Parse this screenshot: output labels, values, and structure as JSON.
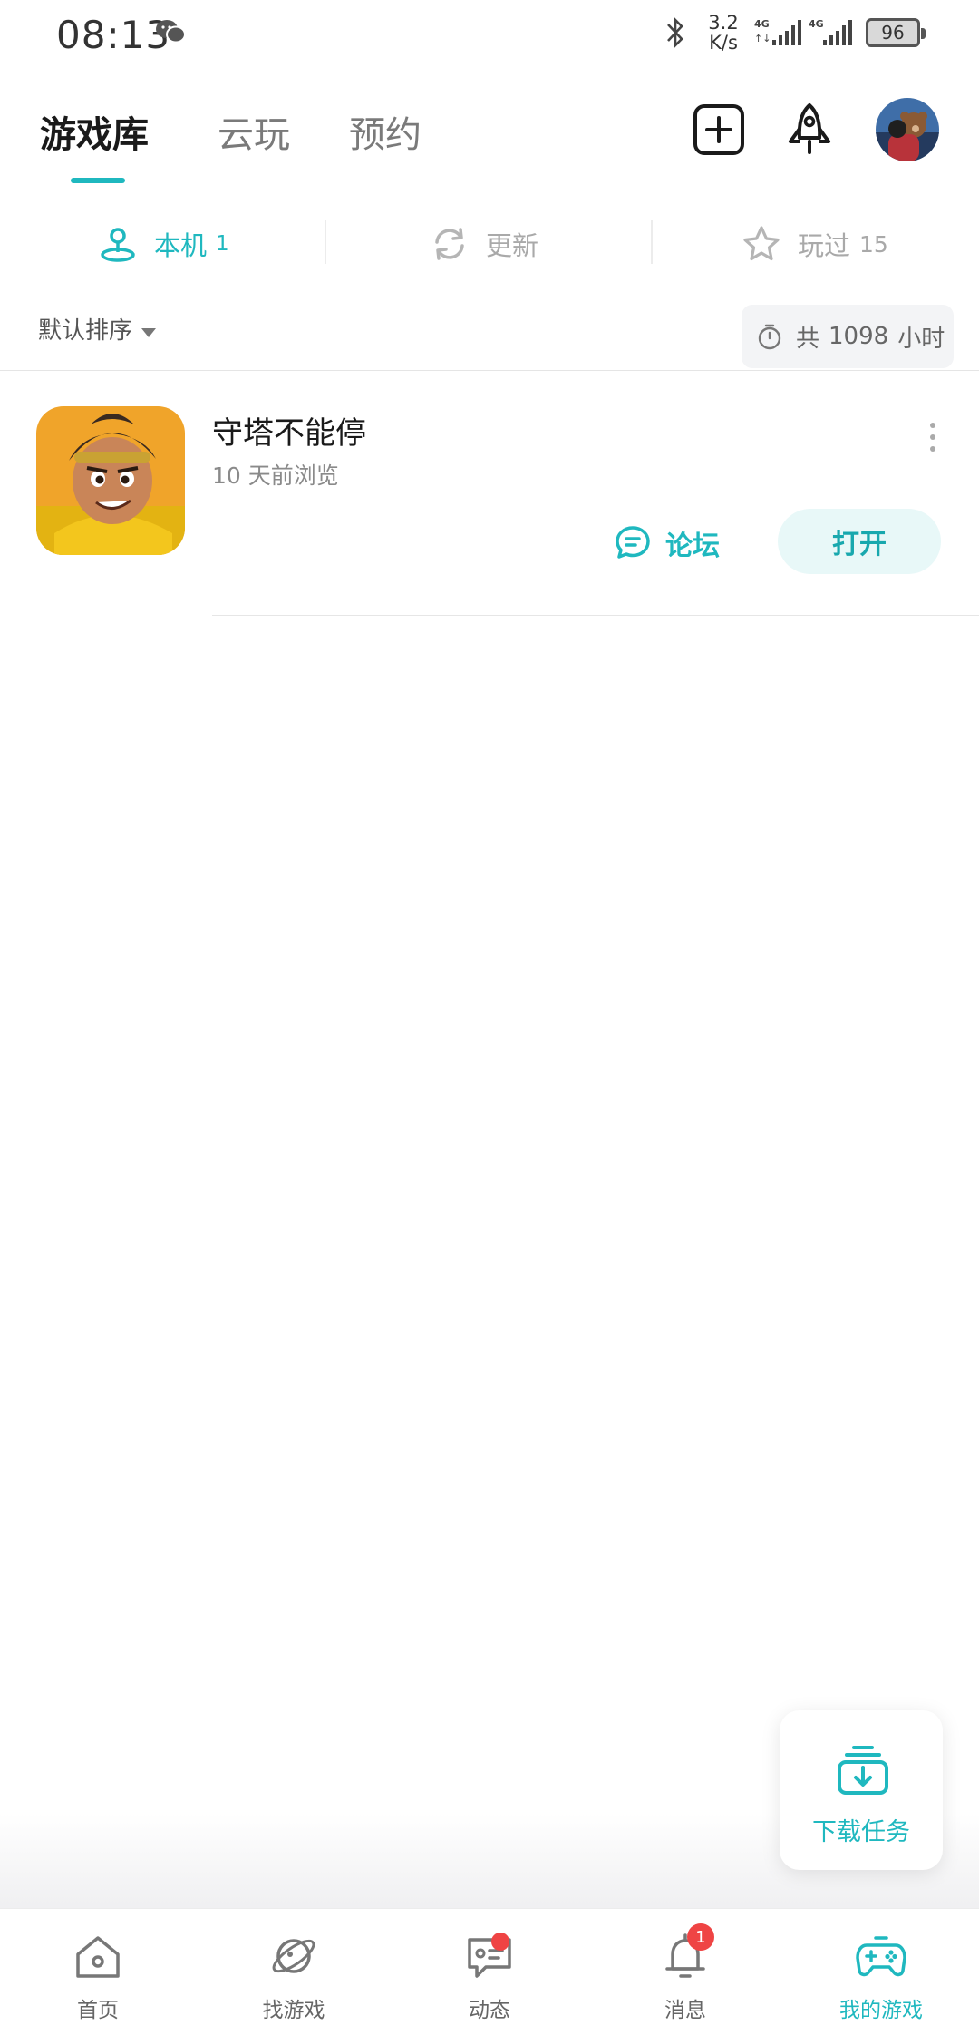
{
  "status_bar": {
    "time": "08:13",
    "net_speed_value": "3.2",
    "net_speed_unit": "K/s",
    "battery": "96"
  },
  "header": {
    "tabs": [
      {
        "label": "游戏库",
        "active": true
      },
      {
        "label": "云玩",
        "active": false
      },
      {
        "label": "预约",
        "active": false
      }
    ],
    "icons": [
      "add-icon",
      "rocket-icon",
      "avatar"
    ]
  },
  "subtabs": {
    "local": {
      "label": "本机",
      "count": "1"
    },
    "update": {
      "label": "更新"
    },
    "played": {
      "label": "玩过",
      "count": "15"
    }
  },
  "sort": {
    "label": "默认排序",
    "total_prefix": "共",
    "total_hours": "1098",
    "total_suffix": "小时"
  },
  "games": [
    {
      "name": "守塔不能停",
      "subtitle": "10 天前浏览",
      "forum_label": "论坛",
      "open_label": "打开"
    }
  ],
  "download_tasks": {
    "label": "下载任务"
  },
  "bottom_nav": [
    {
      "label": "首页",
      "icon": "home-icon"
    },
    {
      "label": "找游戏",
      "icon": "planet-icon"
    },
    {
      "label": "动态",
      "icon": "chat-icon"
    },
    {
      "label": "消息",
      "icon": "bell-icon",
      "badge": "1"
    },
    {
      "label": "我的游戏",
      "icon": "gamepad-icon",
      "active": true
    }
  ],
  "colors": {
    "accent": "#1fb8bf",
    "badge": "#ef4444",
    "text_muted": "#8a8a8a"
  }
}
